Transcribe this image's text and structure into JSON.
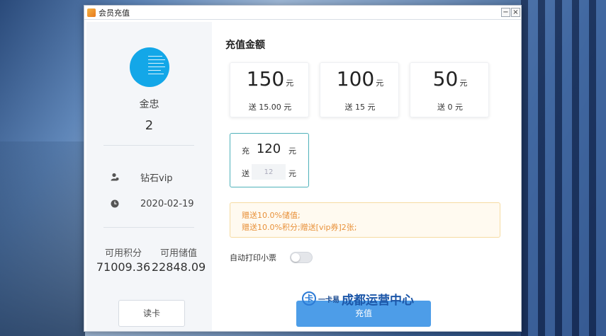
{
  "window": {
    "title": "会员充值",
    "minimize_label": "−",
    "close_label": "×"
  },
  "member": {
    "name": "金忠",
    "level": "2",
    "card_type": "钻石vip",
    "date": "2020-02-19",
    "points_label": "可用积分",
    "points_value": "71009.36",
    "balance_label": "可用储值",
    "balance_value": "22848.09",
    "read_card_label": "读卡"
  },
  "recharge": {
    "title": "充值金额",
    "unit": "元",
    "options": [
      {
        "amount": "150",
        "bonus": "送 15.00 元"
      },
      {
        "amount": "100",
        "bonus": "送 15 元"
      },
      {
        "amount": "50",
        "bonus": "送 0 元"
      }
    ],
    "custom": {
      "charge_label": "充",
      "charge_value": "120",
      "gift_label": "送",
      "gift_value": "12",
      "unit": "元"
    },
    "notice": [
      "赠送10.0%储值;",
      "赠送10.0%积分;赠送[vip券]2张;"
    ],
    "auto_print_label": "自动打印小票",
    "auto_print_on": false,
    "submit_label": "充值"
  },
  "watermark": {
    "mark": "卡",
    "small": "一卡易",
    "big": "成都运营中心"
  },
  "colors": {
    "accent": "#4d9de8",
    "selected_border": "#4fb1ba",
    "notice_text": "#e8913a",
    "avatar": "#13a7e8"
  }
}
